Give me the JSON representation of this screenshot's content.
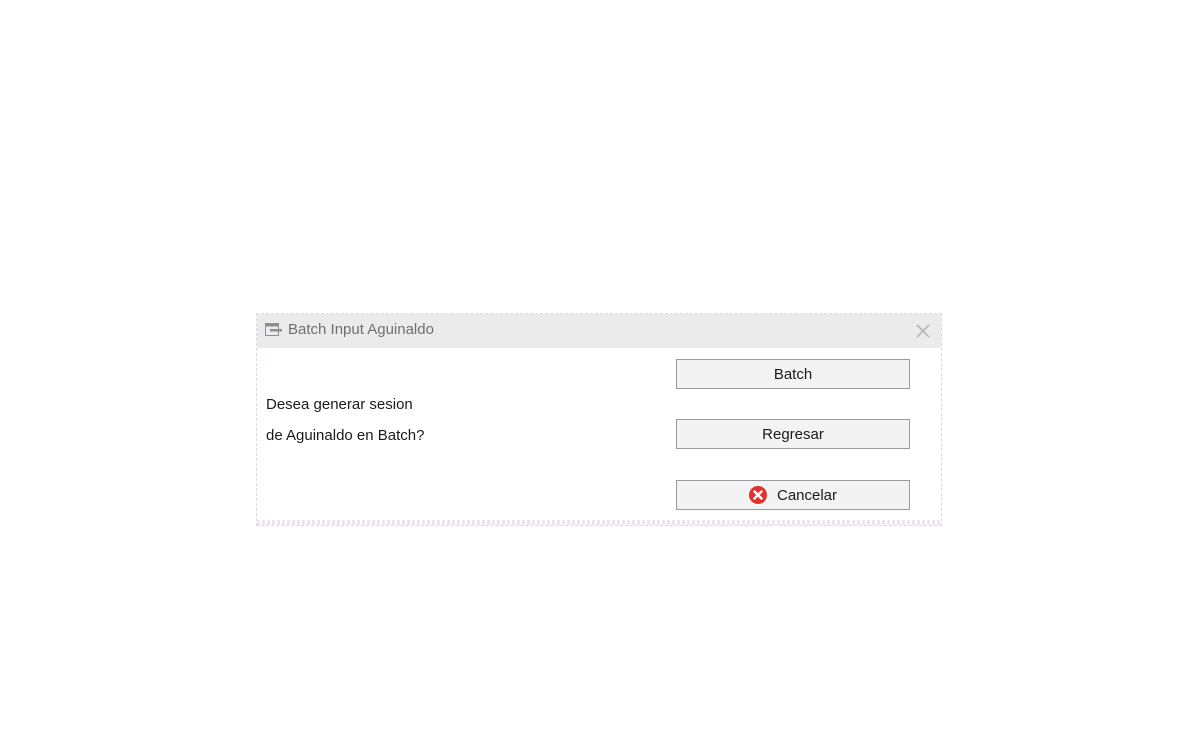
{
  "dialog": {
    "title": "Batch Input Aguinaldo",
    "title_icon": "window-icon",
    "close_icon": "close-icon",
    "message_line1": "Desea generar sesion",
    "message_line2": "de Aguinaldo en Batch?"
  },
  "buttons": {
    "batch_label": "Batch",
    "regresar_label": "Regresar",
    "cancelar_label": "Cancelar",
    "cancelar_icon": "cancel-circle-icon"
  },
  "colors": {
    "titlebar_bg": "#ebebeb",
    "button_border": "#9a9a9a",
    "cancel_icon_red": "#e0322d"
  }
}
